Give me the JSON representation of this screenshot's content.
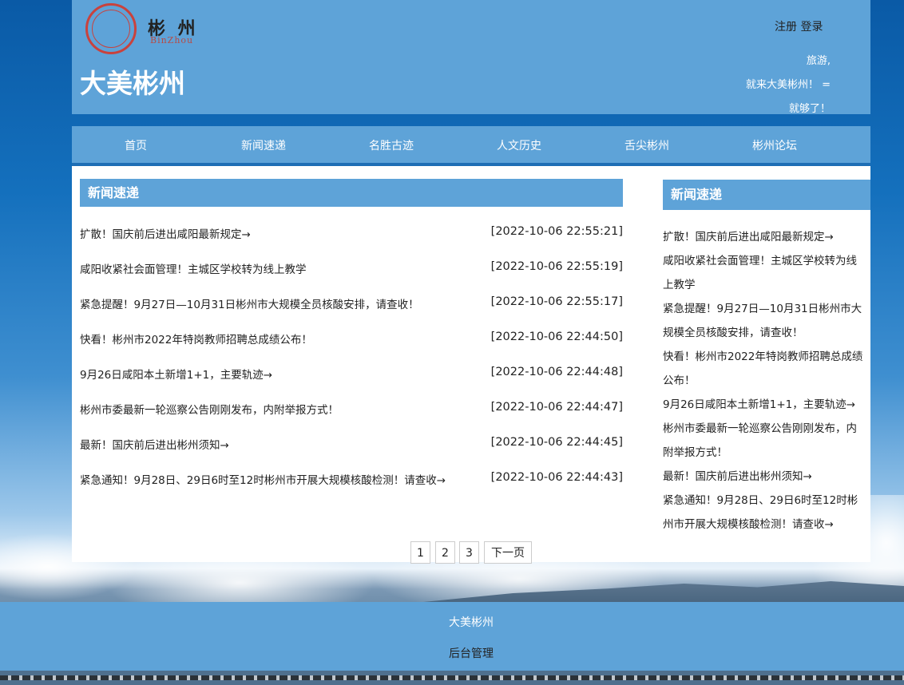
{
  "header": {
    "logo_cn": "彬 州",
    "logo_en": "BinZhou",
    "site_title": "大美彬州",
    "register": "注册",
    "login": "登录",
    "slogan": [
      "旅游,",
      "就来大美彬州！ =",
      "就够了！"
    ]
  },
  "nav": [
    "首页",
    "新闻速递",
    "名胜古迹",
    "人文历史",
    "舌尖彬州",
    "彬州论坛"
  ],
  "main": {
    "heading": "新闻速递",
    "news": [
      {
        "title": "扩散！国庆前后进出咸阳最新规定→",
        "date": "[2022-10-06 22:55:21]"
      },
      {
        "title": "咸阳收紧社会面管理！主城区学校转为线上教学",
        "date": "[2022-10-06 22:55:19]"
      },
      {
        "title": "紧急提醒！9月27日—10月31日彬州市大规模全员核酸安排，请查收！",
        "date": "[2022-10-06 22:55:17]"
      },
      {
        "title": "快看！彬州市2022年特岗教师招聘总成绩公布！",
        "date": "[2022-10-06 22:44:50]"
      },
      {
        "title": "9月26日咸阳本土新增1+1，主要轨迹→",
        "date": "[2022-10-06 22:44:48]"
      },
      {
        "title": "彬州市委最新一轮巡察公告刚刚发布，内附举报方式！",
        "date": "[2022-10-06 22:44:47]"
      },
      {
        "title": "最新！国庆前后进出彬州须知→",
        "date": "[2022-10-06 22:44:45]"
      },
      {
        "title": "紧急通知！9月28日、29日6时至12时彬州市开展大规模核酸检测！请查收→",
        "date": "[2022-10-06 22:44:43]"
      }
    ],
    "pager": [
      "1",
      "2",
      "3",
      "下一页"
    ]
  },
  "sidebar": {
    "heading": "新闻速递",
    "lines": [
      "扩散！国庆前后进出咸阳最新规定→",
      "咸阳收紧社会面管理！主城区学校转为线",
      "上教学",
      "紧急提醒！9月27日—10月31日彬州市大",
      "规模全员核酸安排，请查收！",
      "快看！彬州市2022年特岗教师招聘总成绩",
      "公布！",
      "9月26日咸阳本土新增1+1，主要轨迹→",
      "彬州市委最新一轮巡察公告刚刚发布，内",
      "附举报方式！",
      "最新！国庆前后进出彬州须知→",
      "紧急通知！9月28日、29日6时至12时彬",
      "州市开展大规模核酸检测！请查收→"
    ]
  },
  "footer": {
    "line1": "大美彬州",
    "line2": "后台管理"
  }
}
